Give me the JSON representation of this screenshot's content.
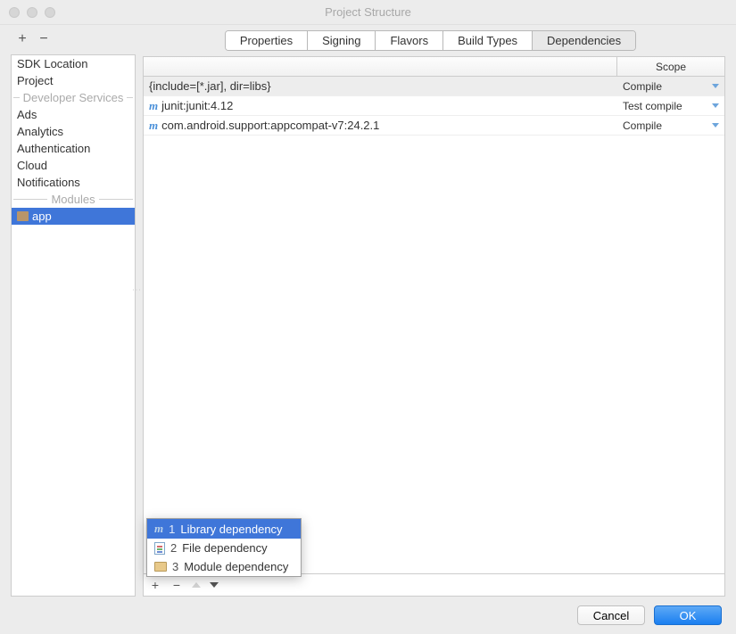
{
  "window": {
    "title": "Project Structure"
  },
  "tabs": [
    {
      "label": "Properties",
      "selected": false
    },
    {
      "label": "Signing",
      "selected": false
    },
    {
      "label": "Flavors",
      "selected": false
    },
    {
      "label": "Build Types",
      "selected": false
    },
    {
      "label": "Dependencies",
      "selected": true
    }
  ],
  "sidebar": {
    "items": [
      {
        "label": "SDK Location",
        "type": "item"
      },
      {
        "label": "Project",
        "type": "item"
      },
      {
        "label": "Developer Services",
        "type": "header"
      },
      {
        "label": "Ads",
        "type": "item"
      },
      {
        "label": "Analytics",
        "type": "item"
      },
      {
        "label": "Authentication",
        "type": "item"
      },
      {
        "label": "Cloud",
        "type": "item"
      },
      {
        "label": "Notifications",
        "type": "item"
      },
      {
        "label": "Modules",
        "type": "header"
      },
      {
        "label": "app",
        "type": "module",
        "selected": true
      }
    ]
  },
  "table": {
    "scope_header": "Scope",
    "rows": [
      {
        "icon": "none",
        "text": "{include=[*.jar], dir=libs}",
        "scope": "Compile",
        "selected": true
      },
      {
        "icon": "maven",
        "text": "junit:junit:4.12",
        "scope": "Test compile"
      },
      {
        "icon": "maven",
        "text": "com.android.support:appcompat-v7:24.2.1",
        "scope": "Compile"
      }
    ]
  },
  "popup": {
    "items": [
      {
        "num": "1",
        "label": "Library dependency",
        "icon": "maven",
        "selected": true
      },
      {
        "num": "2",
        "label": "File dependency",
        "icon": "file"
      },
      {
        "num": "3",
        "label": "Module dependency",
        "icon": "folder"
      }
    ]
  },
  "footer": {
    "cancel": "Cancel",
    "ok": "OK"
  },
  "toolbar": {
    "plus": "+",
    "minus": "−"
  }
}
